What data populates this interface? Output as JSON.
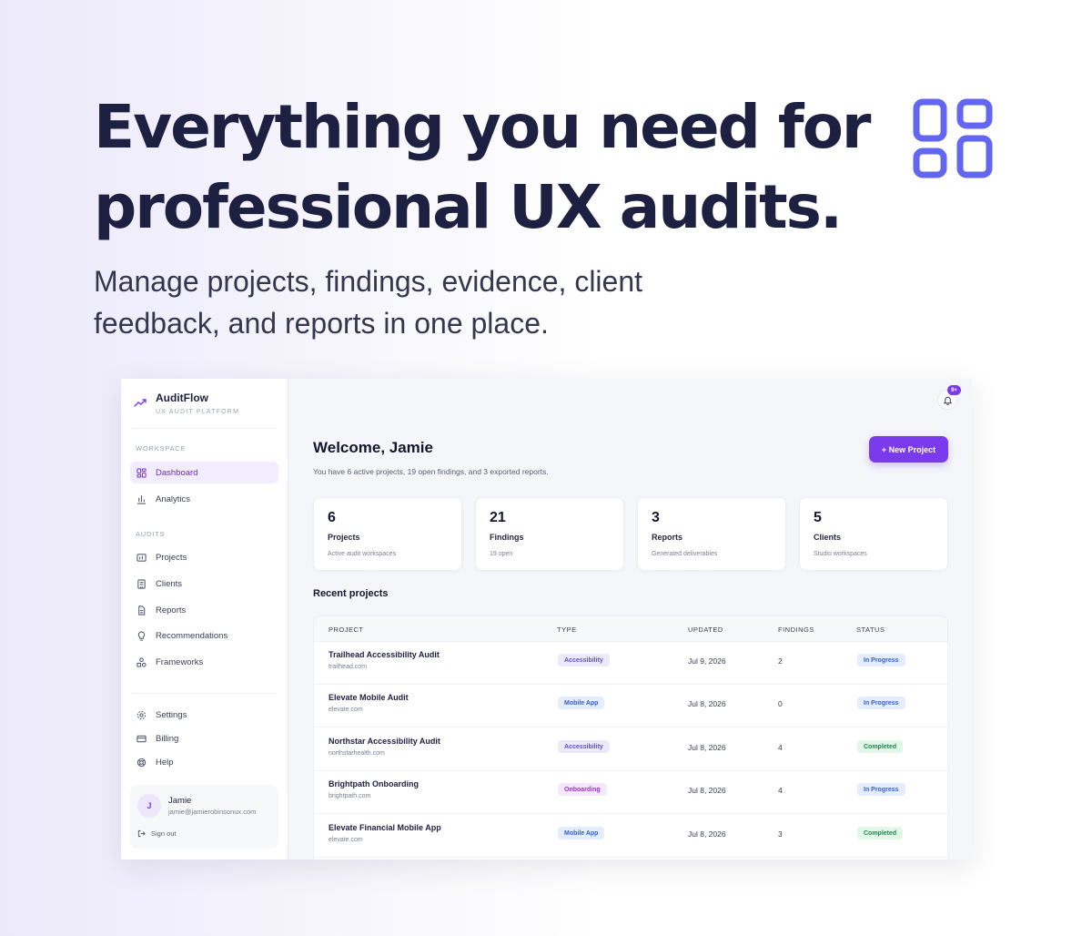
{
  "hero": {
    "headline": "Everything you need for professional UX audits.",
    "subhead": "Manage projects, findings, evidence, client feedback, and reports in one place.",
    "icon": "dashboard-grid-icon"
  },
  "colors": {
    "accent": "#7c3aed",
    "accent_light": "#f1ecfe",
    "hero_icon": "#6366f1",
    "progress_bg": "#e4ecfd",
    "progress_text": "#2f5fd0",
    "completed_bg": "#e2f6e9",
    "completed_text": "#1f8a4c"
  },
  "app": {
    "brand": {
      "name": "AuditFlow",
      "subtitle": "UX AUDIT PLATFORM"
    },
    "sidebar": {
      "workspace_title": "WORKSPACE",
      "workspace_items": [
        {
          "label": "Dashboard",
          "icon": "dashboard-icon",
          "active": true
        },
        {
          "label": "Analytics",
          "icon": "bar-chart-icon"
        }
      ],
      "audits_title": "AUDITS",
      "audits_items": [
        {
          "label": "Projects",
          "icon": "folder-icon"
        },
        {
          "label": "Clients",
          "icon": "building-icon"
        },
        {
          "label": "Reports",
          "icon": "document-icon"
        },
        {
          "label": "Recommendations",
          "icon": "lightbulb-icon"
        },
        {
          "label": "Frameworks",
          "icon": "shapes-icon"
        }
      ],
      "bottom_items": [
        {
          "label": "Settings",
          "icon": "gear-icon"
        },
        {
          "label": "Billing",
          "icon": "credit-card-icon"
        },
        {
          "label": "Help",
          "icon": "lifebuoy-icon"
        }
      ],
      "user": {
        "initial": "J",
        "name": "Jamie",
        "email": "jamie@jamierobinsonux.com",
        "signout": "Sign out"
      }
    },
    "header": {
      "notification_count": "9+"
    },
    "welcome": {
      "title": "Welcome, Jamie",
      "subtitle": "You have 6 active projects, 19 open findings, and 3 exported reports.",
      "new_project": "+ New Project"
    },
    "stats": [
      {
        "value": "6",
        "label": "Projects",
        "sub": "Active audit workspaces"
      },
      {
        "value": "21",
        "label": "Findings",
        "sub": "19 open"
      },
      {
        "value": "3",
        "label": "Reports",
        "sub": "Generated deliverables"
      },
      {
        "value": "5",
        "label": "Clients",
        "sub": "Studio workspaces"
      }
    ],
    "recent": {
      "title": "Recent projects",
      "columns": [
        "PROJECT",
        "TYPE",
        "UPDATED",
        "FINDINGS",
        "STATUS"
      ],
      "rows": [
        {
          "name": "Trailhead Accessibility Audit",
          "url": "trailhead.com",
          "type": "Accessibility",
          "updated": "Jul 9, 2026",
          "findings": "2",
          "status": "In Progress"
        },
        {
          "name": "Elevate Mobile Audit",
          "url": "elevate.com",
          "type": "Mobile App",
          "updated": "Jul 8, 2026",
          "findings": "0",
          "status": "In Progress"
        },
        {
          "name": "Northstar Accessibility Audit",
          "url": "northstarhealth.com",
          "type": "Accessibility",
          "updated": "Jul 8, 2026",
          "findings": "4",
          "status": "Completed"
        },
        {
          "name": "Brightpath Onboarding",
          "url": "brightpath.com",
          "type": "Onboarding",
          "updated": "Jul 8, 2026",
          "findings": "4",
          "status": "In Progress"
        },
        {
          "name": "Elevate Financial Mobile App",
          "url": "elevate.com",
          "type": "Mobile App",
          "updated": "Jul 8, 2026",
          "findings": "3",
          "status": "Completed"
        }
      ]
    }
  }
}
